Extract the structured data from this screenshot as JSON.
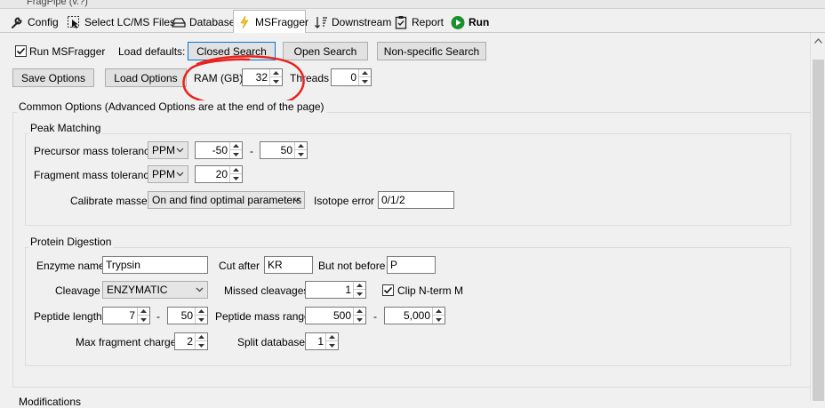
{
  "window": {
    "title": "FragPipe (v.?)"
  },
  "tabs": [
    {
      "label": "Config",
      "icon": "wrench-icon"
    },
    {
      "label": "Select LC/MS Files",
      "icon": "select-cursor-icon"
    },
    {
      "label": "Database",
      "icon": "database-icon"
    },
    {
      "label": "MSFragger",
      "icon": "lightning-icon",
      "selected": true
    },
    {
      "label": "Downstream",
      "icon": "sort-arrows-icon"
    },
    {
      "label": "Report",
      "icon": "clipboard-icon"
    },
    {
      "label": "Run",
      "icon": "play-icon"
    }
  ],
  "top": {
    "run_msfragger": "Run MSFragger",
    "load_defaults": "Load defaults:",
    "closed_search": "Closed Search",
    "open_search": "Open Search",
    "nonspecific_search": "Non-specific Search",
    "save_options": "Save Options",
    "load_options": "Load Options",
    "ram_label": "RAM (GB)",
    "ram_value": "32",
    "threads_label": "Threads",
    "threads_value": "0"
  },
  "common": {
    "title": "Common Options (Advanced Options are at the end of the page)",
    "peak_matching": {
      "title": "Peak Matching",
      "precursor_label": "Precursor mass tolerance",
      "precursor_unit": "PPM",
      "precursor_low": "-50",
      "dash": "-",
      "precursor_high": "50",
      "fragment_label": "Fragment mass tolerance",
      "fragment_unit": "PPM",
      "fragment_value": "20",
      "calibrate_label": "Calibrate masses",
      "calibrate_value": "On and find optimal parameters",
      "isotope_label": "Isotope error",
      "isotope_value": "0/1/2"
    },
    "digestion": {
      "title": "Protein Digestion",
      "enzyme_label": "Enzyme name",
      "enzyme_value": "Trypsin",
      "cut_after_label": "Cut after",
      "cut_after_value": "KR",
      "not_before_label": "But not before",
      "not_before_value": "P",
      "cleavage_label": "Cleavage",
      "cleavage_value": "ENZYMATIC",
      "missed_label": "Missed cleavages",
      "missed_value": "1",
      "clip_label": "Clip N-term M",
      "peptide_length_label": "Peptide length",
      "peptide_length_min": "7",
      "peptide_length_max": "50",
      "mass_range_label": "Peptide mass range",
      "mass_range_min": "500",
      "mass_range_max": "5,000",
      "max_charge_label": "Max fragment charge",
      "max_charge_value": "2",
      "split_db_label": "Split database",
      "split_db_value": "1"
    },
    "modifications_title": "Modifications"
  },
  "colors": {
    "annotation_red": "#e8221e",
    "run_green": "#1a8f2a",
    "focus_blue": "#0078d7"
  }
}
